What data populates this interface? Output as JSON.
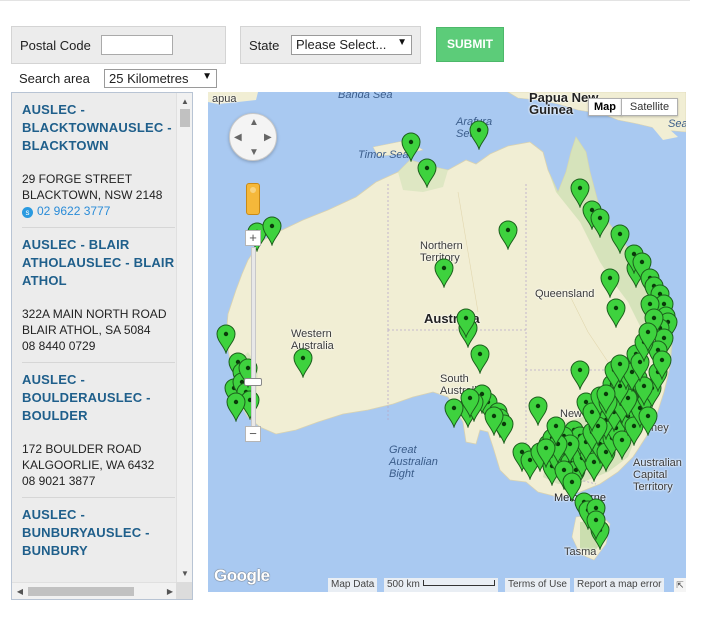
{
  "search": {
    "postal_code_label": "Postal Code",
    "postal_code_value": "",
    "state_label": "State",
    "state_selected": "Please Select...",
    "submit_label": "SUBMIT",
    "search_area_label": "Search area",
    "search_area_selected": "25 Kilometres"
  },
  "stores": [
    {
      "name": "AUSLEC - BLACKTOWNAUSLEC - BLACKTOWN",
      "address1": "29 FORGE STREET",
      "address2": "BLACKTOWN, NSW 2148",
      "phone": "02 9622 3777",
      "phone_is_link": true
    },
    {
      "name": "AUSLEC - BLAIR ATHOLAUSLEC - BLAIR ATHOL",
      "address1": "322A MAIN NORTH ROAD",
      "address2": "BLAIR ATHOL, SA 5084",
      "phone": "08 8440 0729",
      "phone_is_link": false
    },
    {
      "name": "AUSLEC - BOULDERAUSLEC - BOULDER",
      "address1": "172 BOULDER ROAD",
      "address2": "KALGOORLIE, WA 6432",
      "phone": "08 9021 3877",
      "phone_is_link": false
    },
    {
      "name": "AUSLEC - BUNBURYAUSLEC - BUNBURY",
      "address1": "",
      "address2": "",
      "phone": "",
      "phone_is_link": false
    }
  ],
  "map": {
    "type_map_label": "Map",
    "type_satellite_label": "Satellite",
    "labels": {
      "papua_new_guinea": "Papua New\nGuinea",
      "papua": "apua",
      "banda_sea": "Banda Sea",
      "arafura_sea": "Arafura\nSea",
      "timor_sea": "Timor Sea",
      "coral_sea": "Sea",
      "northern_territory": "Northern\nTerritory",
      "queensland": "Queensland",
      "australia": "Australia",
      "western_australia": "Western\nAustralia",
      "south_australia": "South\nAustralia",
      "new_south_wales": "New South W",
      "sydney": "ney",
      "great_australian_bight": "Great\nAustralian\nBight",
      "act": "Australian\nCapital\nTerritory",
      "melbourne": "Melbourne",
      "tasmania": "Tasma"
    },
    "google_logo": "Google",
    "footer": {
      "map_data": "Map Data",
      "scale": "500 km",
      "terms": "Terms of Use",
      "report": "Report a map error"
    },
    "marker_color": "#3ed23e",
    "marker_count": 120
  },
  "colors": {
    "submit_bg": "#5ccc79",
    "store_name": "#1f5f8b",
    "water": "#a9c9f1",
    "land": "#f1eed4"
  }
}
